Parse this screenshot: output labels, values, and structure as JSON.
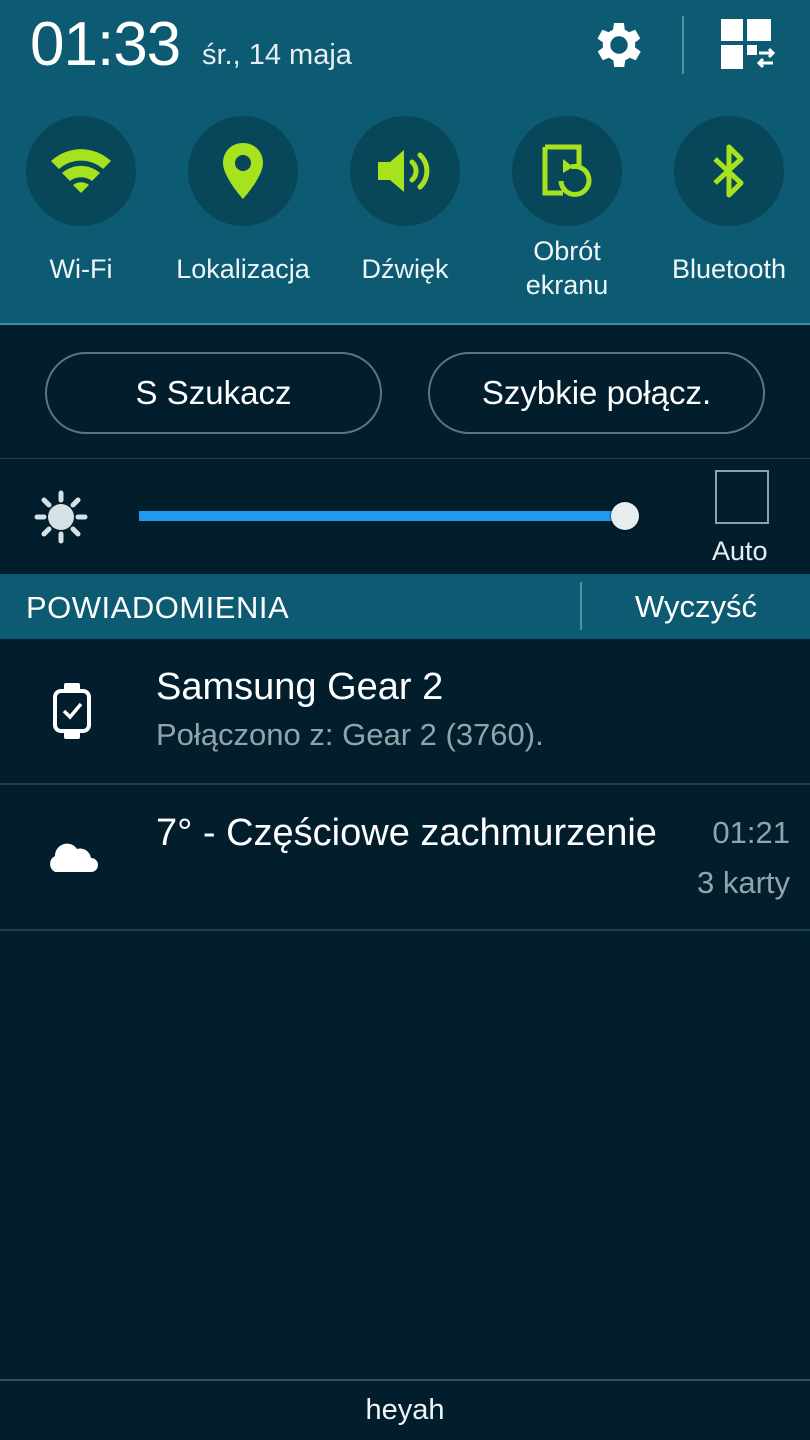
{
  "header": {
    "time": "01:33",
    "date": "śr., 14 maja"
  },
  "quick_toggles": [
    {
      "icon": "wifi-icon",
      "label": "Wi-Fi"
    },
    {
      "icon": "location-pin-icon",
      "label": "Lokalizacja"
    },
    {
      "icon": "speaker-icon",
      "label": "Dźwięk"
    },
    {
      "icon": "rotate-screen-icon",
      "label_line1": "Obrót",
      "label_line2": "ekranu"
    },
    {
      "icon": "bluetooth-icon",
      "label": "Bluetooth"
    }
  ],
  "quick_buttons": {
    "s_finder": "S Szukacz",
    "quick_connect": "Szybkie połącz."
  },
  "brightness": {
    "level": 1.0,
    "auto_label": "Auto",
    "auto_checked": false
  },
  "notifications": {
    "title": "POWIADOMIENIA",
    "clear_label": "Wyczyść",
    "items": [
      {
        "icon": "smartwatch-icon",
        "title": "Samsung Gear 2",
        "subtitle": "Połączono z: Gear 2 (3760)."
      },
      {
        "icon": "cloud-icon",
        "title": "7° - Częściowe zachmurzenie",
        "time": "01:21",
        "count": "3 karty"
      }
    ]
  },
  "carrier": "heyah",
  "colors": {
    "panel": "#0d5b73",
    "background": "#021e2c",
    "icon_accent": "#a6e21e",
    "slider_fill": "#1e9bf0"
  }
}
